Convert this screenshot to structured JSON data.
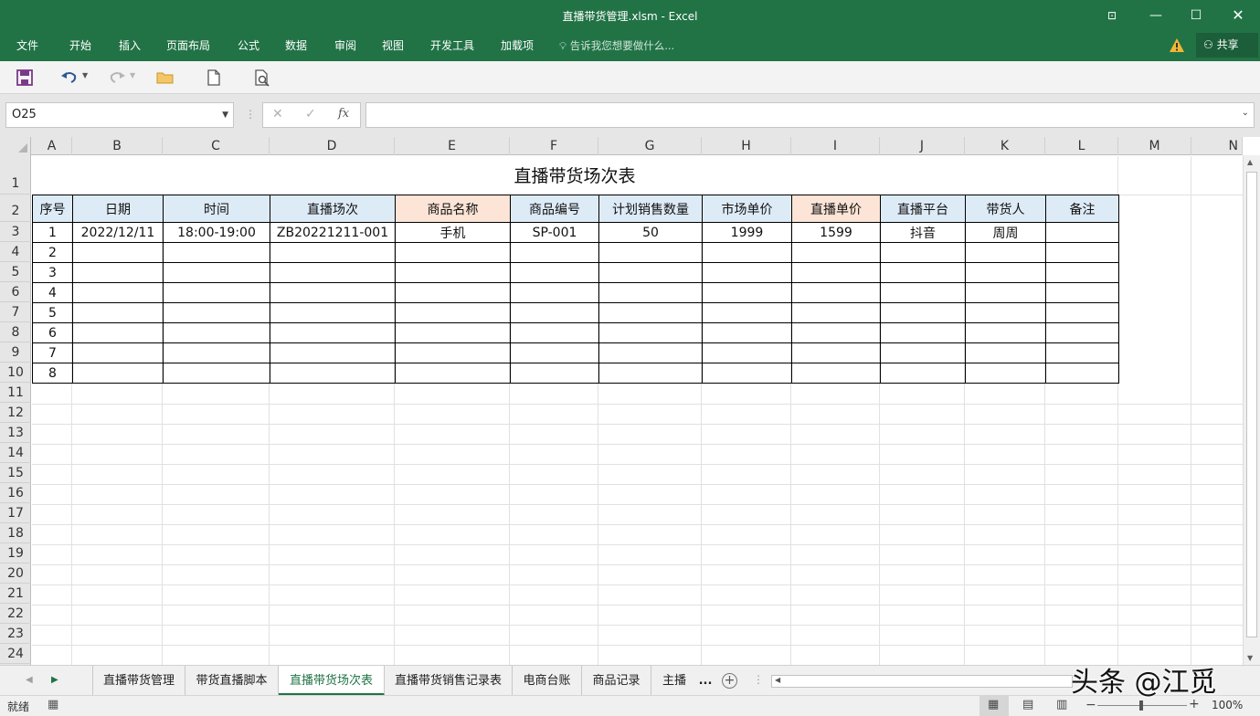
{
  "window": {
    "title": "直播带货管理.xlsm  -  Excel"
  },
  "menu": {
    "items": [
      "文件",
      "开始",
      "插入",
      "页面布局",
      "公式",
      "数据",
      "审阅",
      "视图",
      "开发工具",
      "加载项"
    ],
    "tell_me": "告诉我您想要做什么...",
    "share": "共享"
  },
  "formula_bar": {
    "name_box": "O25",
    "formula": ""
  },
  "columns": [
    "A",
    "B",
    "C",
    "D",
    "E",
    "F",
    "G",
    "H",
    "I",
    "J",
    "K",
    "L",
    "M",
    "N"
  ],
  "rows": [
    "1",
    "2",
    "3",
    "4",
    "5",
    "6",
    "7",
    "8",
    "9",
    "10",
    "11",
    "12",
    "13",
    "14",
    "15",
    "16",
    "17",
    "18",
    "19",
    "20",
    "21",
    "22",
    "23",
    "24"
  ],
  "sheet": {
    "title": "直播带货场次表",
    "headers": [
      "序号",
      "日期",
      "时间",
      "直播场次",
      "商品名称",
      "商品编号",
      "计划销售数量",
      "市场单价",
      "直播单价",
      "直播平台",
      "带货人",
      "备注"
    ],
    "highlight_header_color": "#fce4d6",
    "header_color": "#ddebf7",
    "rows": [
      [
        "1",
        "2022/12/11",
        "18:00-19:00",
        "ZB20221211-001",
        "手机",
        "SP-001",
        "50",
        "1999",
        "1599",
        "抖音",
        "周周",
        ""
      ],
      [
        "2",
        "",
        "",
        "",
        "",
        "",
        "",
        "",
        "",
        "",
        "",
        ""
      ],
      [
        "3",
        "",
        "",
        "",
        "",
        "",
        "",
        "",
        "",
        "",
        "",
        ""
      ],
      [
        "4",
        "",
        "",
        "",
        "",
        "",
        "",
        "",
        "",
        "",
        "",
        ""
      ],
      [
        "5",
        "",
        "",
        "",
        "",
        "",
        "",
        "",
        "",
        "",
        "",
        ""
      ],
      [
        "6",
        "",
        "",
        "",
        "",
        "",
        "",
        "",
        "",
        "",
        "",
        ""
      ],
      [
        "7",
        "",
        "",
        "",
        "",
        "",
        "",
        "",
        "",
        "",
        "",
        ""
      ],
      [
        "8",
        "",
        "",
        "",
        "",
        "",
        "",
        "",
        "",
        "",
        "",
        ""
      ]
    ]
  },
  "tabs": {
    "items": [
      "直播带货管理",
      "带货直播脚本",
      "直播带货场次表",
      "直播带货销售记录表",
      "电商台账",
      "商品记录",
      "主播"
    ],
    "active": "直播带货场次表",
    "more": "..."
  },
  "status": {
    "ready": "就绪",
    "zoom": "100%"
  },
  "watermark": "头条 @江觅",
  "accent_color": "#217346"
}
